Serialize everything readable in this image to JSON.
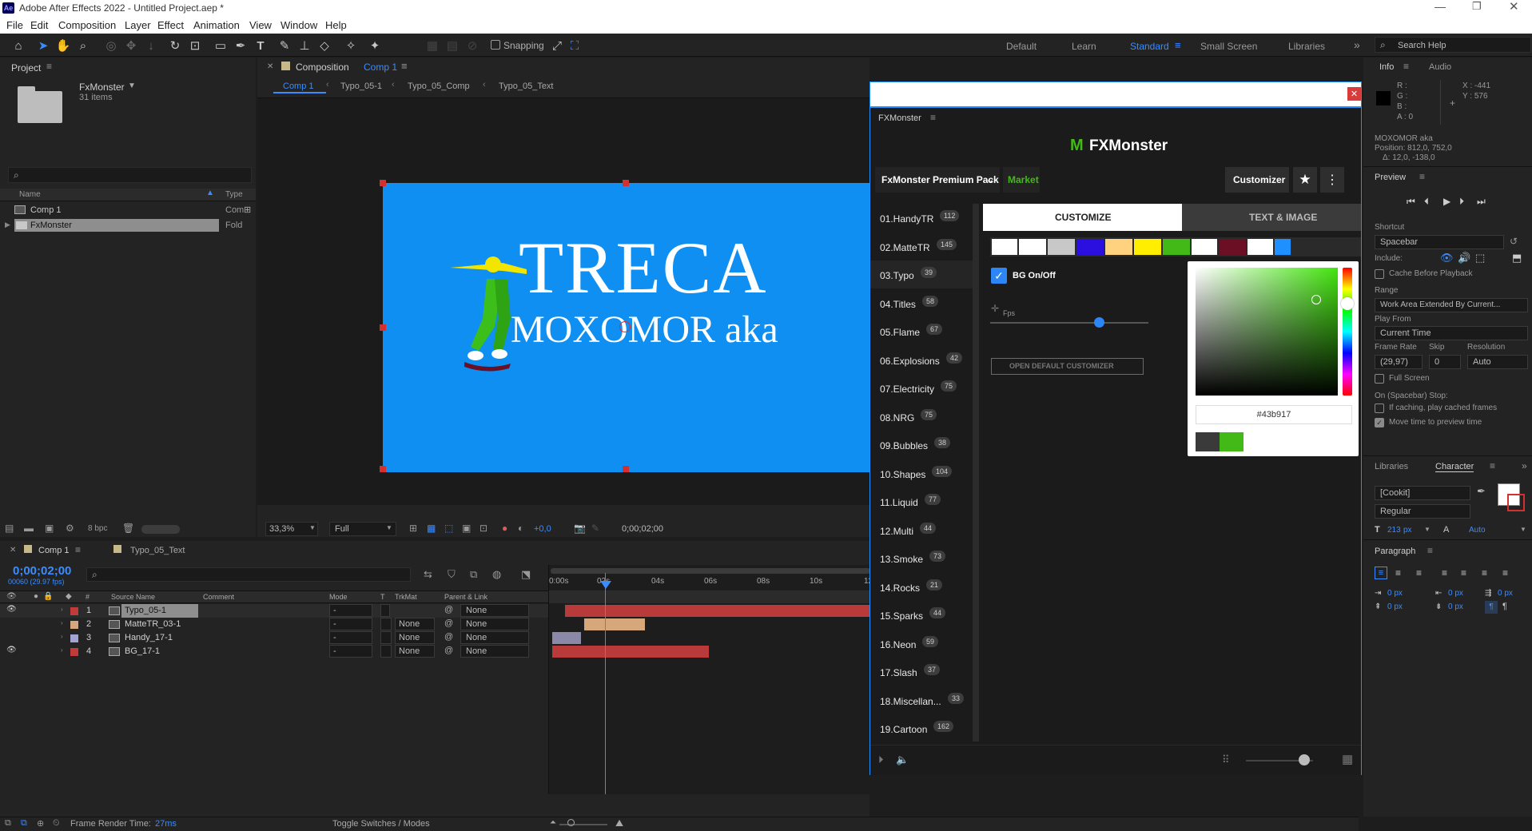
{
  "app": {
    "title": "Adobe After Effects 2022 - Untitled Project.aep *",
    "logo": "Ae"
  },
  "menu": [
    "File",
    "Edit",
    "Composition",
    "Layer",
    "Effect",
    "Animation",
    "View",
    "Window",
    "Help"
  ],
  "toolbar": {
    "snapping_label": "Snapping"
  },
  "workspaces": [
    "Default",
    "Learn",
    "Standard",
    "Small Screen",
    "Libraries"
  ],
  "active_workspace": "Standard",
  "search_help": "Search Help",
  "project": {
    "title": "Project",
    "folder_name": "FxMonster",
    "folder_count": "31 items",
    "col_name": "Name",
    "col_type": "Type",
    "items": [
      {
        "name": "Comp 1",
        "type": "Com"
      },
      {
        "name": "FxMonster",
        "type": "Fold"
      }
    ],
    "bpc": "8 bpc"
  },
  "composition": {
    "title_prefix": "Composition",
    "title_comp": "Comp 1",
    "breadcrumbs": [
      "Comp 1",
      "Typo_05-1",
      "Typo_05_Comp",
      "Typo_05_Text"
    ],
    "headline": "TRECA",
    "subline": "MOXOMOR aka",
    "zoom": "33,3%",
    "resolution": "Full",
    "exposure": "+0,0",
    "timecode": "0;00;02;00",
    "colors": {
      "canvas": "#0f8ff2"
    }
  },
  "timeline": {
    "tabs": [
      "Comp 1",
      "Typo_05_Text"
    ],
    "timecode": "0;00;02;00",
    "frames": "00060 (29.97 fps)",
    "columns": [
      "#",
      "Source Name",
      "Comment",
      "Mode",
      "T",
      "TrkMat",
      "Parent & Link"
    ],
    "ruler": [
      "0:00s",
      "02s",
      "04s",
      "06s",
      "08s",
      "10s",
      "12"
    ],
    "layers": [
      {
        "num": "1",
        "name": "Typo_05-1",
        "mode": "-",
        "trkmat": "",
        "parent": "None",
        "color": "#c23b3b"
      },
      {
        "num": "2",
        "name": "MatteTR_03-1",
        "mode": "-",
        "trkmat": "None",
        "parent": "None",
        "color": "#d6a77a"
      },
      {
        "num": "3",
        "name": "Handy_17-1",
        "mode": "-",
        "trkmat": "None",
        "parent": "None",
        "color": "#a3a3d6"
      },
      {
        "num": "4",
        "name": "BG_17-1",
        "mode": "-",
        "trkmat": "None",
        "parent": "None",
        "color": "#c23b3b"
      }
    ],
    "render_label": "Frame Render Time:",
    "render_value": "27ms",
    "toggle_label": "Toggle Switches / Modes"
  },
  "fxmonster": {
    "panel_title": "FXMonster",
    "brand": "FXMonster",
    "pack": "FxMonster Premium Pack",
    "market": "Market",
    "customizer": "Customizer",
    "tab_customize": "CUSTOMIZE",
    "tab_text_image": "TEXT & IMAGE",
    "bg_toggle": "BG On/Off",
    "fps_label": "Fps",
    "open_default": "OPEN DEFAULT CUSTOMIZER",
    "hex_value": "#43b917",
    "swatches": [
      "#ffffff",
      "#ffffff",
      "#c8c8c8",
      "#2b0fe0",
      "#ffd27f",
      "#ffee00",
      "#43b917",
      "#ffffff",
      "#6b0f24",
      "#ffffff",
      "#1e90ff"
    ],
    "categories": [
      {
        "name": "01.HandyTR",
        "count": "112"
      },
      {
        "name": "02.MatteTR",
        "count": "145"
      },
      {
        "name": "03.Typo",
        "count": "39"
      },
      {
        "name": "04.Titles",
        "count": "58"
      },
      {
        "name": "05.Flame",
        "count": "67"
      },
      {
        "name": "06.Explosions",
        "count": "42"
      },
      {
        "name": "07.Electricity",
        "count": "75"
      },
      {
        "name": "08.NRG",
        "count": "75"
      },
      {
        "name": "09.Bubbles",
        "count": "38"
      },
      {
        "name": "10.Shapes",
        "count": "104"
      },
      {
        "name": "11.Liquid",
        "count": "77"
      },
      {
        "name": "12.Multi",
        "count": "44"
      },
      {
        "name": "13.Smoke",
        "count": "73"
      },
      {
        "name": "14.Rocks",
        "count": "21"
      },
      {
        "name": "15.Sparks",
        "count": "44"
      },
      {
        "name": "16.Neon",
        "count": "59"
      },
      {
        "name": "17.Slash",
        "count": "37"
      },
      {
        "name": "18.Miscellan...",
        "count": "33"
      },
      {
        "name": "19.Cartoon",
        "count": "162"
      }
    ],
    "colors": {
      "accent": "#43b917",
      "border": "#1e90ff"
    }
  },
  "info": {
    "tabs": [
      "Info",
      "Audio"
    ],
    "r": "R :",
    "g": "G :",
    "b": "B :",
    "a": "A : 0",
    "x": "X : -441",
    "y": "Y : 576",
    "layer_name": "MOXOMOR aka",
    "position": "Position: 812,0, 752,0",
    "delta": "Δ: 12,0, -138,0"
  },
  "preview": {
    "title": "Preview",
    "shortcut_label": "Shortcut",
    "shortcut": "Spacebar",
    "include": "Include:",
    "cache": "Cache Before Playback",
    "range_label": "Range",
    "range": "Work Area Extended By Current...",
    "play_from_label": "Play From",
    "play_from": "Current Time",
    "frame_rate_label": "Frame Rate",
    "skip_label": "Skip",
    "resolution_label": "Resolution",
    "frame_rate": "(29,97)",
    "skip": "0",
    "resolution": "Auto",
    "full_screen": "Full Screen",
    "stop_label": "On (Spacebar) Stop:",
    "if_caching": "If caching, play cached frames",
    "move_time": "Move time to preview time"
  },
  "character": {
    "tabs": [
      "Libraries",
      "Character"
    ],
    "font": "[Cookit]",
    "style": "Regular",
    "size": "213",
    "size_unit": "px",
    "leading": "Auto"
  },
  "paragraph": {
    "title": "Paragraph",
    "indent": [
      "0 px",
      "0 px",
      "0 px",
      "0 px",
      "0 px"
    ]
  }
}
